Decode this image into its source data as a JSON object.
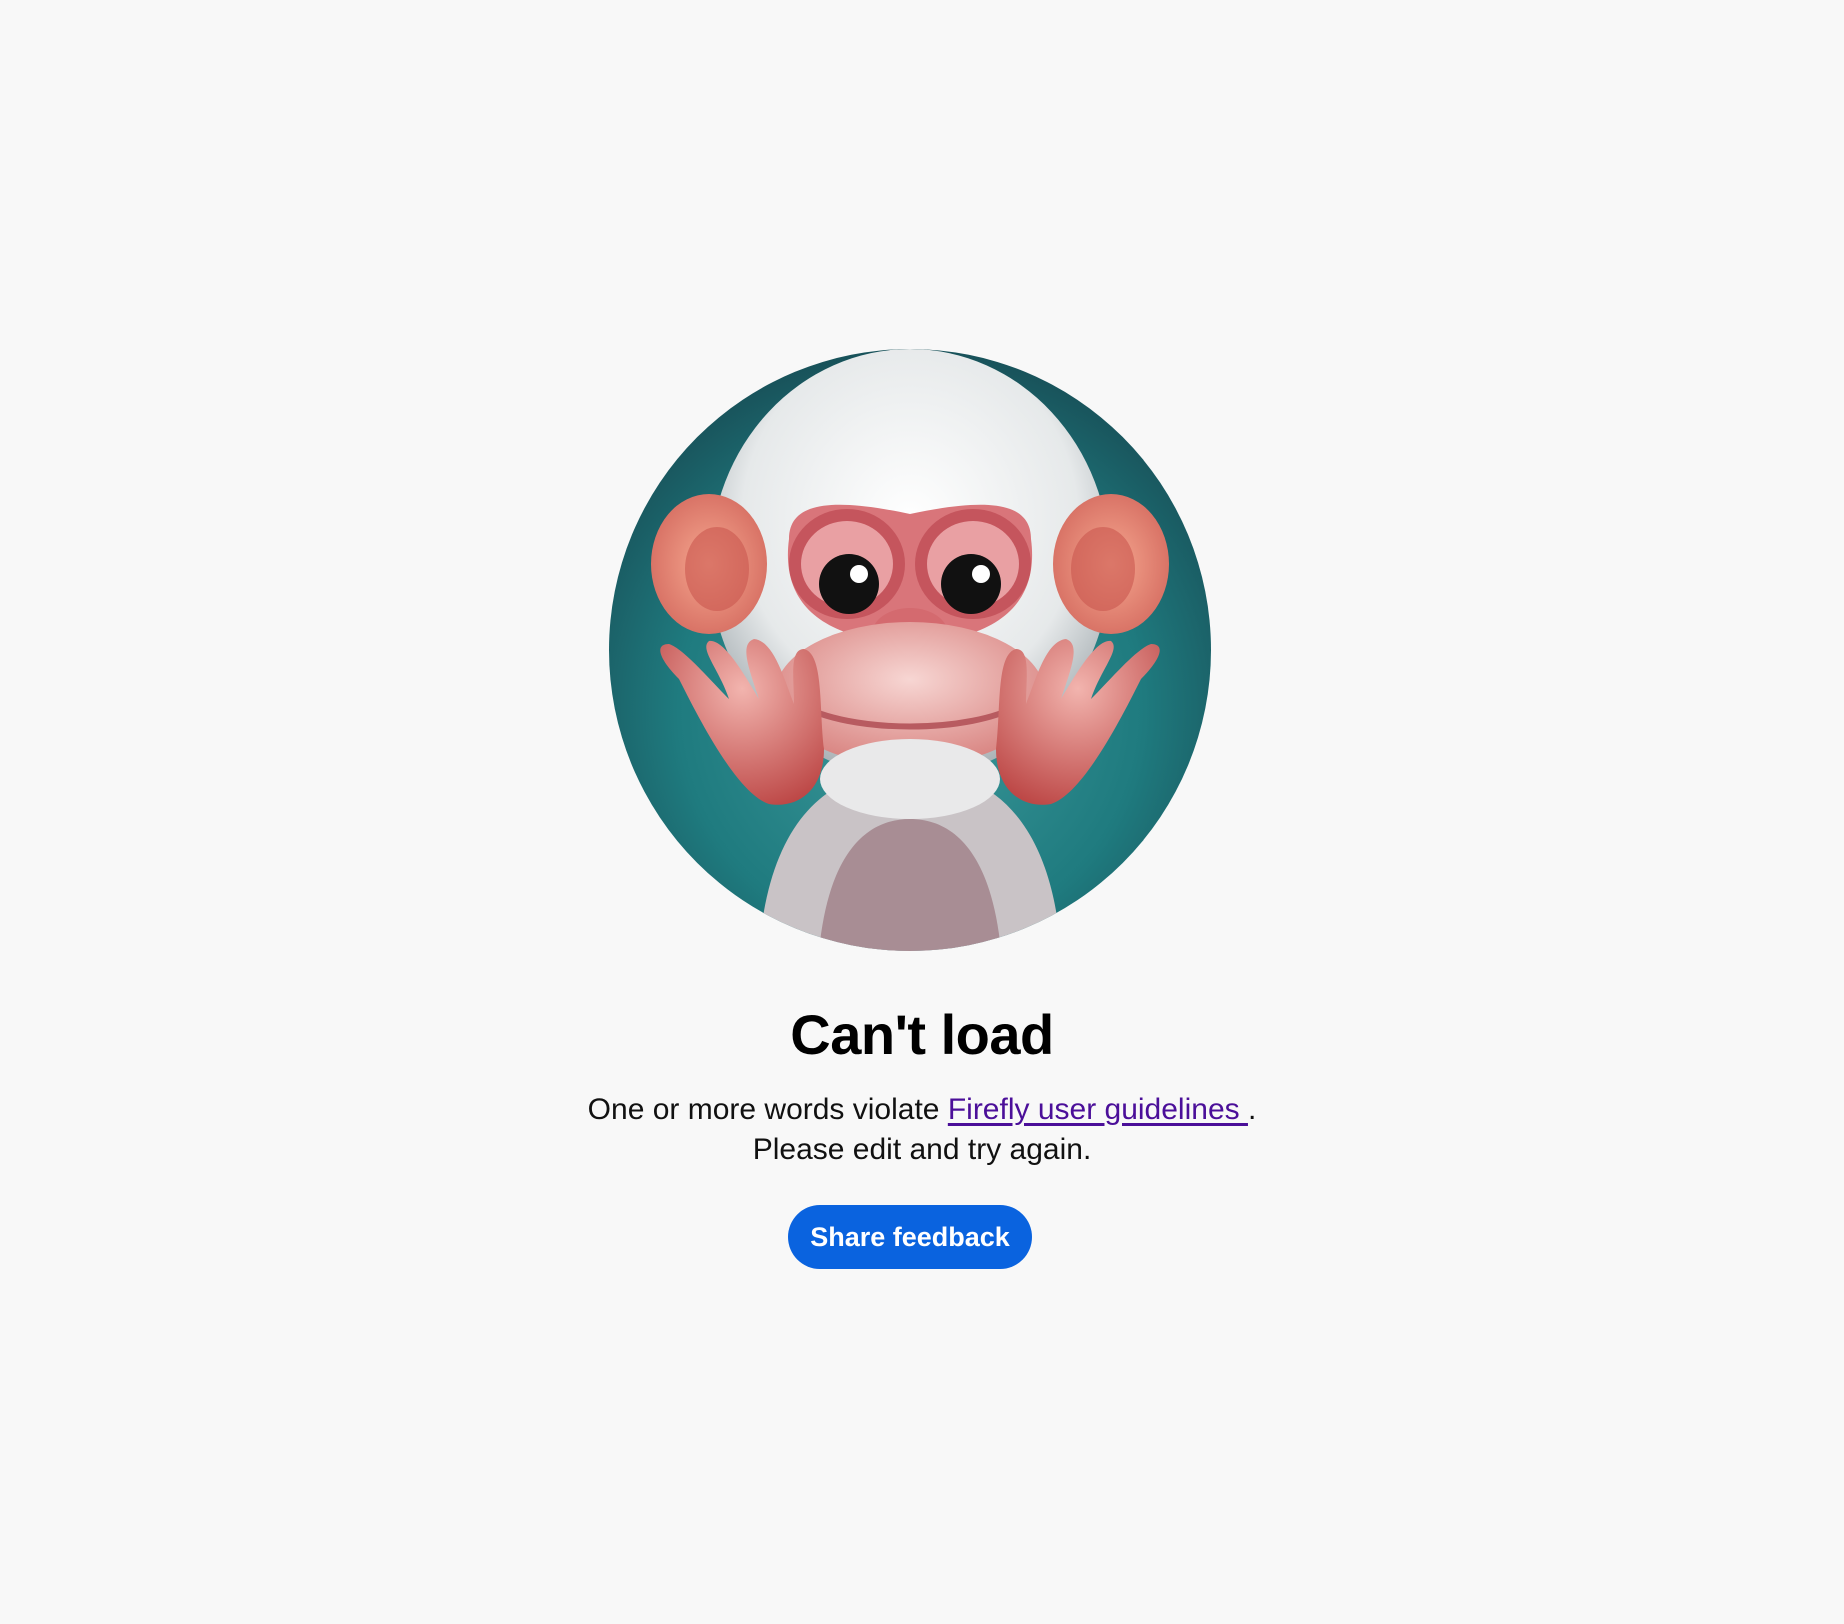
{
  "error": {
    "illustration_icon": "monkey-illustration-icon",
    "title": "Can't load",
    "message_prefix": "One or more words violate ",
    "guidelines_link_label": "Firefly user guidelines ",
    "message_suffix": ".",
    "message_line2": "Please edit and try again.",
    "feedback_button_label": "Share feedback"
  },
  "colors": {
    "background": "#f8f8f8",
    "link": "#4b0f99",
    "button": "#0a63df",
    "button_text": "#ffffff"
  }
}
